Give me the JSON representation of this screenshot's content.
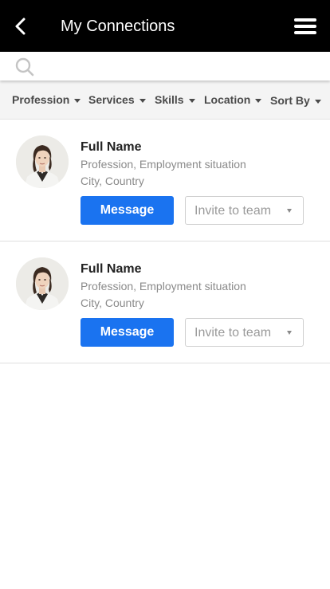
{
  "header": {
    "title": "My Connections",
    "back_icon": "chevron-left-icon",
    "menu_icon": "hamburger-menu-icon"
  },
  "search": {
    "icon": "search-icon",
    "value": "",
    "placeholder": ""
  },
  "filters": [
    {
      "label": "Profession"
    },
    {
      "label": "Services"
    },
    {
      "label": "Skills"
    },
    {
      "label": "Location"
    },
    {
      "label": "Sort By"
    }
  ],
  "connections": [
    {
      "name": "Full Name",
      "profession": "Profession, Employment situation",
      "location": "City, Country",
      "message_label": "Message",
      "invite_label": "Invite to team"
    },
    {
      "name": "Full Name",
      "profession": "Profession, Employment situation",
      "location": "City, Country",
      "message_label": "Message",
      "invite_label": "Invite to team"
    }
  ],
  "colors": {
    "header_bg": "#000000",
    "accent": "#1a73f0",
    "filter_bg": "#f4f4f4"
  }
}
